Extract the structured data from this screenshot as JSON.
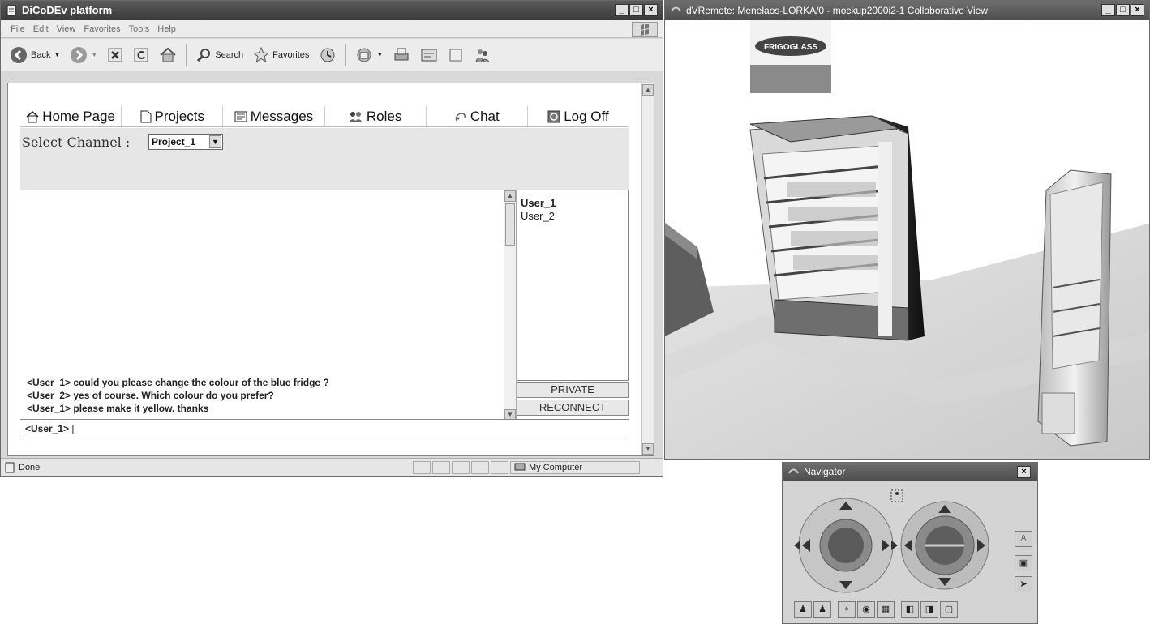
{
  "browser": {
    "title": "DiCoDEv platform",
    "menu": [
      "File",
      "Edit",
      "View",
      "Favorites",
      "Tools",
      "Help"
    ],
    "toolbar": {
      "back": "Back",
      "search": "Search",
      "favorites": "Favorites"
    },
    "status": {
      "left": "Done",
      "zone": "My Computer"
    }
  },
  "app": {
    "tabs": [
      {
        "label": "Home Page",
        "icon": "house-icon"
      },
      {
        "label": "Projects",
        "icon": "page-icon"
      },
      {
        "label": "Messages",
        "icon": "note-icon"
      },
      {
        "label": "Roles",
        "icon": "roles-icon"
      },
      {
        "label": "Chat",
        "icon": "chat-icon"
      },
      {
        "label": "Log Off",
        "icon": "power-icon"
      }
    ],
    "channel_label": "Select Channel :",
    "channel_value": "Project_1",
    "messages": [
      "<User_1> could you please change the colour of the blue fridge ?",
      "<User_2> yes of course. Which colour do you prefer?",
      "<User_1> please make it yellow. thanks"
    ],
    "users": [
      "User_1",
      "User_2"
    ],
    "private_button": "PRIVATE",
    "reconnect_button": "RECONNECT",
    "input_prefix": "<User_1>",
    "input_value": ""
  },
  "dvremote": {
    "title": "dVRemote: Menelaos-LORKA/0 - mockup2000i2-1 Collaborative View",
    "brand_logo": "FRIGOGLASS"
  },
  "navigator": {
    "title": "Navigator"
  },
  "colors": {
    "titlebar": "#4a4a4a",
    "chrome": "#d8d8d8",
    "content": "#ffffff"
  }
}
